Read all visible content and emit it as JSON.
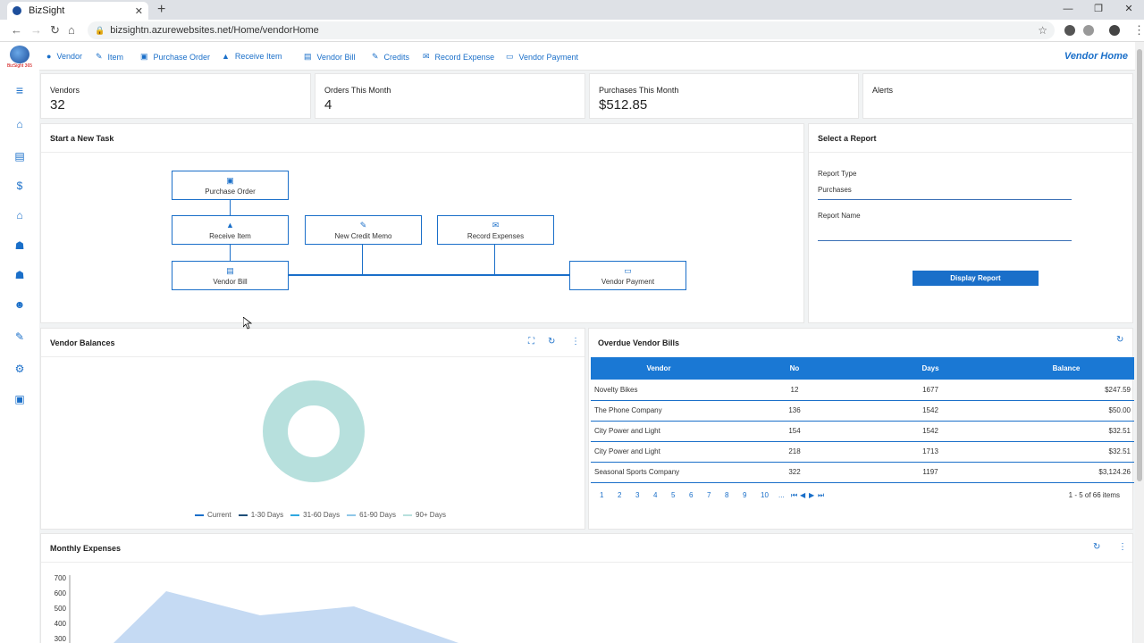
{
  "browser": {
    "tab_title": "BizSight",
    "tab_close": "✕",
    "new_tab": "+",
    "url": "bizsightn.azurewebsites.net/Home/vendorHome",
    "window_controls": [
      "—",
      "❐",
      "✕"
    ]
  },
  "logo": {
    "text": "BizSight 365"
  },
  "topnav": {
    "items": [
      {
        "label": "Vendor",
        "icon": "person-icon"
      },
      {
        "label": "Item",
        "icon": "wrench-icon"
      },
      {
        "label": "Purchase Order",
        "icon": "copy-icon"
      },
      {
        "label": "Receive Item",
        "icon": "thumbs-up-icon"
      },
      {
        "label": "Vendor Bill",
        "icon": "bill-icon"
      },
      {
        "label": "Credits",
        "icon": "edit-icon"
      },
      {
        "label": "Record Expense",
        "icon": "inbox-icon"
      },
      {
        "label": "Vendor Payment",
        "icon": "card-icon"
      }
    ],
    "page_title": "Vendor Home"
  },
  "stats": [
    {
      "label": "Vendors",
      "value": "32"
    },
    {
      "label": "Orders This Month",
      "value": "4"
    },
    {
      "label": "Purchases This Month",
      "value": "$512.85"
    },
    {
      "label": "Alerts",
      "value": ""
    }
  ],
  "tasks": {
    "title": "Start a New Task",
    "boxes": {
      "purchase_order": "Purchase Order",
      "receive_item": "Receive Item",
      "vendor_bill": "Vendor Bill",
      "new_credit_memo": "New Credit Memo",
      "record_expenses": "Record Expenses",
      "vendor_payment": "Vendor Payment"
    }
  },
  "report": {
    "title": "Select a Report",
    "type_label": "Report Type",
    "type_value": "Purchases",
    "name_label": "Report Name",
    "name_value": "",
    "button": "Display Report"
  },
  "vendor_balances": {
    "title": "Vendor Balances",
    "legend": [
      {
        "label": "Current",
        "color": "#1a6fc9"
      },
      {
        "label": "1-30 Days",
        "color": "#1f4e79"
      },
      {
        "label": "31-60 Days",
        "color": "#2fa8e0"
      },
      {
        "label": "61-90 Days",
        "color": "#8fc7e8"
      },
      {
        "label": "90+ Days",
        "color": "#b7e0dd"
      }
    ],
    "donut_color": "#b7e0dd"
  },
  "overdue": {
    "title": "Overdue Vendor Bills",
    "columns": [
      "Vendor",
      "No",
      "Days",
      "Balance"
    ],
    "rows": [
      [
        "Novelty Bikes",
        "12",
        "1677",
        "$247.59"
      ],
      [
        "The Phone Company",
        "136",
        "1542",
        "$50.00"
      ],
      [
        "City Power and Light",
        "154",
        "1542",
        "$32.51"
      ],
      [
        "City Power and Light",
        "218",
        "1713",
        "$32.51"
      ],
      [
        "Seasonal Sports Company",
        "322",
        "1197",
        "$3,124.26"
      ]
    ],
    "pages": [
      "1",
      "2",
      "3",
      "4",
      "5",
      "6",
      "7",
      "8",
      "9",
      "10",
      "...",
      "⏮",
      "◀",
      "▶",
      "⏭"
    ],
    "page_info": "1 - 5 of 66 items"
  },
  "monthly": {
    "title": "Monthly Expenses",
    "y_ticks": [
      "700",
      "600",
      "500",
      "400",
      "300"
    ],
    "area_color": "#c5daf3"
  },
  "colors": {
    "accent": "#1a6fc9",
    "header": "#1a78d4"
  }
}
